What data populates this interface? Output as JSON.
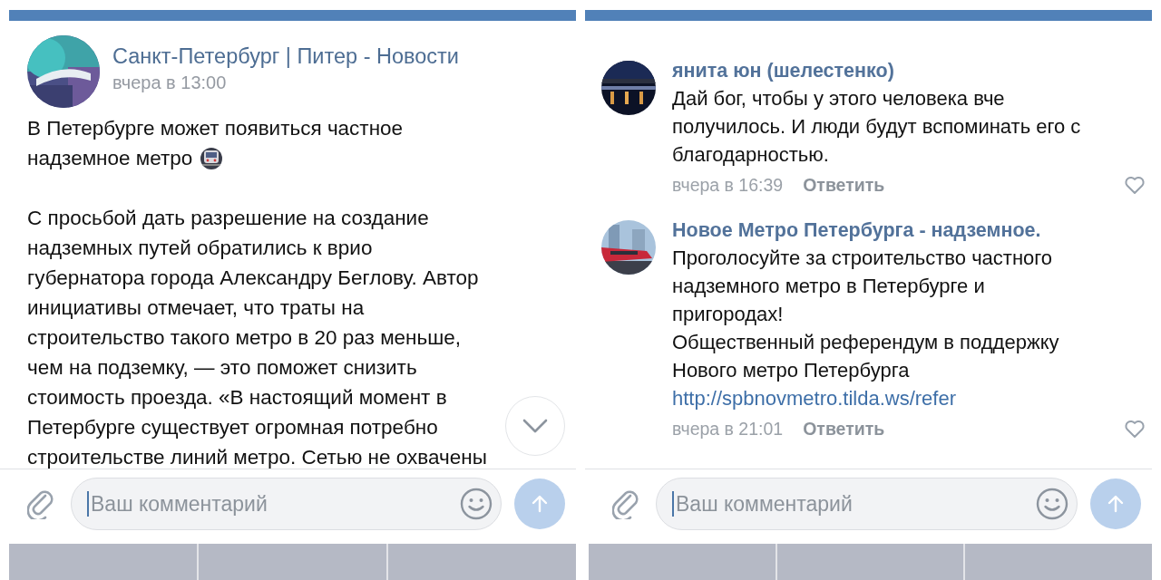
{
  "panels": [
    {
      "kind": "post",
      "post": {
        "author": "Санкт-Петербург | Питер - Новости",
        "time": "вчера в 13:00",
        "paragraphs": [
          [
            "В Петербурге может появиться частное",
            "надземное метро"
          ],
          [
            "С просьбой дать разрешение на создание",
            "надземных путей обратились к врио",
            "губернатора города Александру Беглову. Автор",
            "инициативы отмечает, что траты на",
            "строительство такого метро в 20 раз меньше,",
            "чем на подземку, — это поможет снизить",
            "стоимость проезда. «В настоящий момент в",
            "Петербурге существует огромная потребно",
            "строительстве линий метро. Сетью не охвачены"
          ]
        ]
      },
      "composer": {
        "placeholder": "Ваш комментарий"
      }
    },
    {
      "kind": "comments",
      "comments": [
        {
          "author": "янита юн (шелестенко)",
          "lines": [
            "Дай бог, чтобы у этого человека вче",
            "получилось. И люди будут вспоминать его с",
            "благодарностью."
          ],
          "time": "вчера в 16:39",
          "reply": "Ответить",
          "liked": false
        },
        {
          "author": "Новое Метро Петербурга - надземное.",
          "lines": [
            "Проголосуйте за строительство частного",
            "надземного метро в Петербурге и",
            "пригородах!",
            "Общественный референдум в поддержку",
            "Нового метро Петербурга"
          ],
          "link": "http://spbnovmetro.tilda.ws/refer",
          "time": "вчера в 21:01",
          "reply": "Ответить",
          "liked": false
        }
      ],
      "composer": {
        "placeholder": "Ваш комментарий"
      }
    }
  ]
}
